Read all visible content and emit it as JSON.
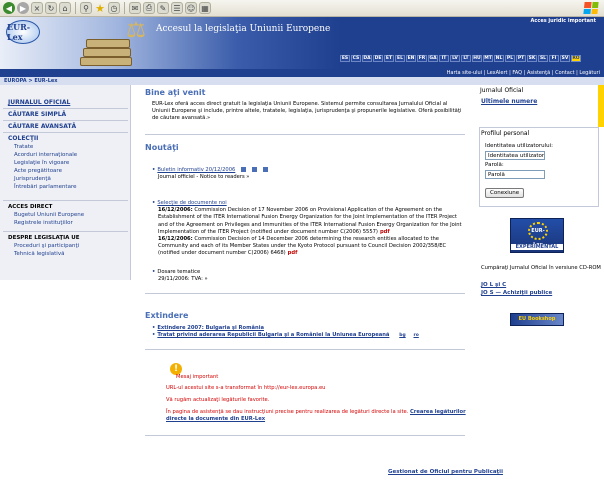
{
  "banner": {
    "title": "Accesul la legislaţia Uniunii Europene",
    "logo_text": "EUR-Lex",
    "access_link": "Acces juridic important",
    "languages": [
      "ES",
      "CS",
      "DA",
      "DE",
      "ET",
      "EL",
      "EN",
      "FR",
      "GA",
      "IT",
      "LV",
      "LT",
      "HU",
      "MT",
      "NL",
      "PL",
      "PT",
      "SK",
      "SL",
      "FI",
      "SV",
      "RO"
    ],
    "current_language": "RO"
  },
  "topnav": [
    "Harta site-ului",
    "LexAlert",
    "FAQ",
    "Asistenţă",
    "Contact",
    "Legături"
  ],
  "breadcrumb": "EUROPA > EUR-Lex",
  "sidebar": {
    "main": [
      {
        "label": "JURNALUL OFICIAL",
        "active": true
      },
      {
        "label": "CĂUTARE SIMPLĂ"
      },
      {
        "label": "CĂUTARE AVANSATĂ"
      },
      {
        "label": "COLECŢII"
      }
    ],
    "collections": [
      "Tratate",
      "Acorduri internaţionale",
      "Legislaţie în vigoare",
      "Acte pregătitoare",
      "Jurisprudenţă",
      "Întrebări parlamentare"
    ],
    "direct_head": "ACCES DIRECT",
    "direct": [
      "Bugetul Uniunii Europene",
      "Registrele instituţiilor"
    ],
    "about_head": "DESPRE LEGISLAŢIA UE",
    "about": [
      "Proceduri şi participanţi",
      "Tehnică legislativă"
    ]
  },
  "welcome": {
    "title": "Bine aţi venit",
    "text": "EUR-Lex oferă acces direct gratuit la legislaţia Uniunii Europene. Sistemul permite consultarea Jurnalului Oficial al Uniunii Europene şi include, printre altele, tratatele, legislaţia, jurisprudenţa şi propunerile legislative. Oferă posibilităţi de căutare avansată.»"
  },
  "news": {
    "title": "Noutăţi",
    "items": [
      {
        "link": "Buletin informativ 20/12/2006",
        "sub": "Journal officiel - Notice to readers »"
      },
      {
        "link": "Selecţie de documente noi",
        "doc1_date": "16/12/2006:",
        "doc1_text": " Commission Decision of 17 November 2006 on Provisional Application of the Agreement on the Establishment of the ITER International Fusion Energy Organization for the Joint Implementation of the ITER Project and of the Agreement on Privileges and Immunities of the ITER International Fusion Energy Organization for the Joint Implementation of the ITER Project (notified under document number C(2006) 5557)",
        "doc2_date": "16/12/2006:",
        "doc2_text": " Commission Decision of 14 December 2006 determining the research entities allocated to the Community and each of its Member States under the Kyoto Protocol pursuant to Council Decision 2002/358/EC (notified under document number C(2006) 6468)",
        "pdf": "pdf"
      },
      {
        "plain": "Dosare tematice",
        "sub": "29/11/2006: TVA: »"
      }
    ]
  },
  "extension": {
    "title": "Extindere",
    "links": [
      "Extindere 2007: Bulgaria şi România",
      "Tratat privind aderarea Republicii Bulgaria şi a României la Uniunea Europeană"
    ],
    "lang_tags": [
      "bg",
      "ro"
    ]
  },
  "important": {
    "title": "Mesaj important",
    "line1": "URL-ul acestui site s-a transformat în http://eur-lex.europa.eu",
    "line2": "Vă rugăm actualizaţi legăturile favorite.",
    "line3": "În pagina de asistenţă se dau instrucţiuni precise pentru realizarea de legături directe la site.",
    "line3_link": "Crearea legăturilor directe la documente din EUR-Lex"
  },
  "right": {
    "oj_head": "Jurnalul Oficial",
    "oj_link": "Ultimele numere",
    "profile_head": "Profilul personal",
    "user_label": "Identitatea utilizatorului:",
    "user_value": "Identitatea utilizatoru",
    "pass_label": "Parolă:",
    "pass_value": "Parolă",
    "connect": "Conexiune",
    "exp_ring": "EUR-Lex",
    "exp_label": "EXPERIMENTAL",
    "buy_text": "Cumpăraţi Jurnalul Oficial în versiune CD-ROM",
    "buy_links": [
      "JO L şi C",
      "JO S — Achiziţii publice"
    ],
    "cd_logo": "EU Bookshop"
  },
  "footer": "Gestionat de Oficiul pentru Publicaţii"
}
